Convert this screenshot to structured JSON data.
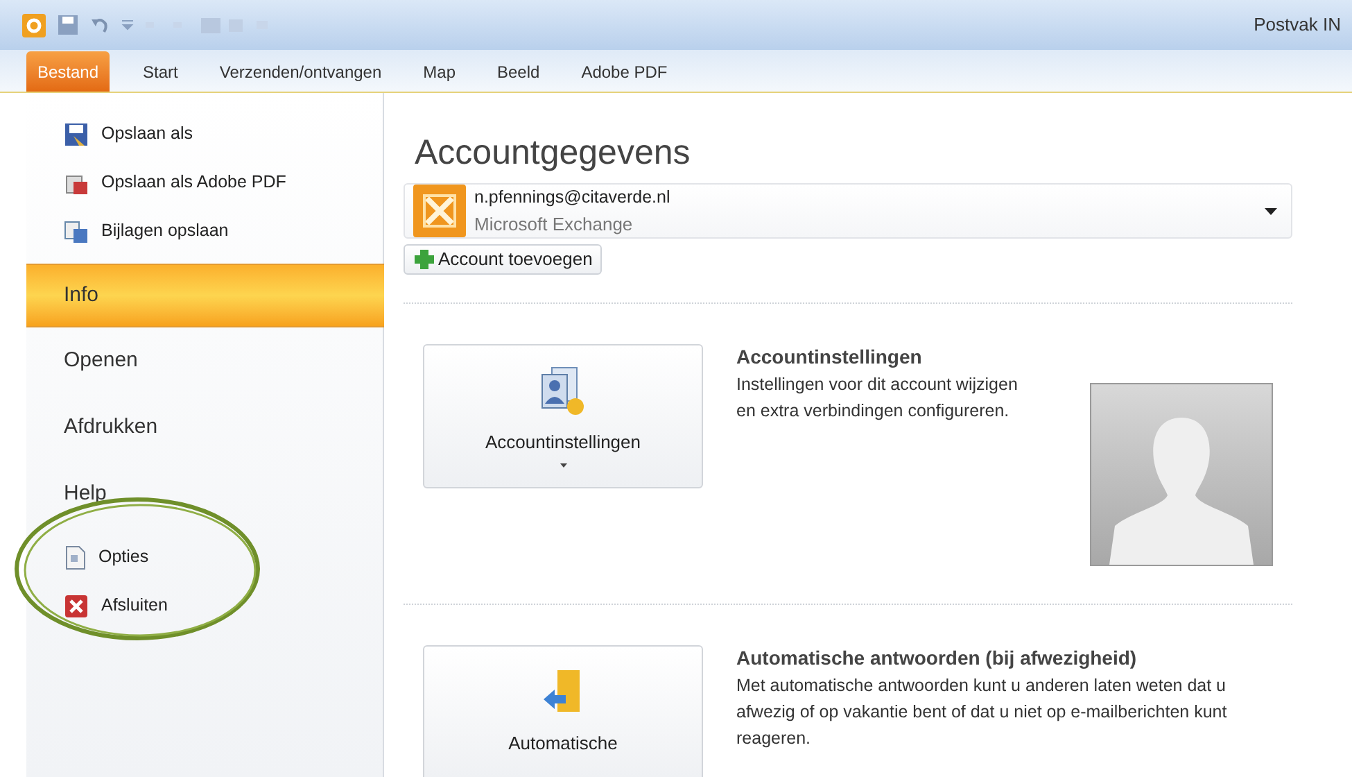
{
  "title_bar": {
    "location": "Postvak IN"
  },
  "tabs": [
    {
      "label": "Bestand",
      "selected": true
    },
    {
      "label": "Start",
      "selected": false
    },
    {
      "label": "Verzenden/ontvangen",
      "selected": false
    },
    {
      "label": "Map",
      "selected": false
    },
    {
      "label": "Beeld",
      "selected": false
    },
    {
      "label": "Adobe PDF",
      "selected": false
    }
  ],
  "sidebar": {
    "items": [
      {
        "kind": "command",
        "label": "Opslaan als",
        "selected": false
      },
      {
        "kind": "command",
        "label": "Opslaan als Adobe PDF",
        "selected": false
      },
      {
        "kind": "command",
        "label": "Bijlagen opslaan",
        "selected": false
      },
      {
        "kind": "nav",
        "label": "Info",
        "selected": true
      },
      {
        "kind": "nav",
        "label": "Openen",
        "selected": false
      },
      {
        "kind": "nav",
        "label": "Afdrukken",
        "selected": false
      },
      {
        "kind": "nav",
        "label": "Help",
        "selected": false
      },
      {
        "kind": "command",
        "label": "Opties",
        "selected": false
      },
      {
        "kind": "command",
        "label": "Afsluiten",
        "selected": false
      }
    ]
  },
  "main": {
    "heading": "Accountgegevens",
    "account": {
      "email": "n.pfennings@citaverde.nl",
      "type": "Microsoft Exchange"
    },
    "add_button": "Account toevoegen",
    "sections": [
      {
        "button_label": "Accountinstellingen",
        "has_menu": true,
        "title": "Accountinstellingen",
        "description": "Instellingen voor dit account wijzigen en extra verbindingen configureren.",
        "avatar": true
      },
      {
        "button_label": "Automatische",
        "has_menu": false,
        "title": "Automatische antwoorden (bij afwezigheid)",
        "description": "Met automatische antwoorden kunt u anderen laten weten dat u afwezig of op vakantie bent of dat u niet op e-mailberichten kunt reageren.",
        "avatar": false
      }
    ]
  }
}
